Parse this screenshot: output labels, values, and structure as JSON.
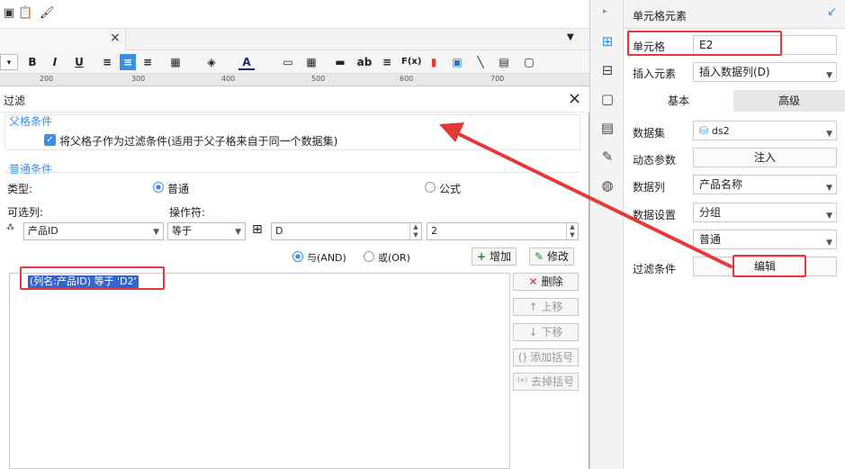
{
  "toolbar": {
    "icons": [
      "save-icon",
      "paste-icon",
      "format-painter-icon"
    ]
  },
  "tab": {
    "close": "×"
  },
  "format_bar": {
    "bold": "B",
    "italic": "I",
    "underline": "U",
    "text_color": "A",
    "ab": "ab",
    "fx": "F(x)"
  },
  "ruler": {
    "ticks": [
      "200",
      "300",
      "400",
      "500",
      "600",
      "700"
    ]
  },
  "dialog": {
    "title": "过滤",
    "close": "×",
    "parent_section": "父格条件",
    "parent_checkbox_label": "将父格子作为过滤条件(适用于父子格来自于同一个数据集)",
    "normal_section": "普通条件",
    "type_label": "类型:",
    "type_normal": "普通",
    "type_formula": "公式",
    "col_label": "可选列:",
    "op_label": "操作符:",
    "col_value": "产品ID",
    "op_value": "等于",
    "value_input": "D",
    "value_input2": "2",
    "and_label": "与(AND)",
    "or_label": "或(OR)",
    "add_btn": "增加",
    "modify_btn": "修改",
    "delete_btn": "删除",
    "up_btn": "上移",
    "down_btn": "下移",
    "add_bracket_btn": "添加括号",
    "remove_bracket_btn": "去掉括号",
    "condition_item": "(列名:产品ID) 等于 'D2'"
  },
  "right_panel": {
    "title": "单元格元素",
    "cell_label": "单元格",
    "cell_value": "E2",
    "insert_label": "插入元素",
    "insert_value": "插入数据列(D)",
    "tab_basic": "基本",
    "tab_advanced": "高级",
    "dataset_label": "数据集",
    "dataset_value": "ds2",
    "param_label": "动态参数",
    "param_btn": "注入",
    "column_label": "数据列",
    "column_value": "产品名称",
    "setting_label": "数据设置",
    "setting_value": "分组",
    "setting_sub_value": "普通",
    "filter_label": "过滤条件",
    "filter_btn": "编辑"
  },
  "colors": {
    "accent": "#3a8ee6",
    "highlight": "#e53935",
    "selection": "#3366cc"
  }
}
